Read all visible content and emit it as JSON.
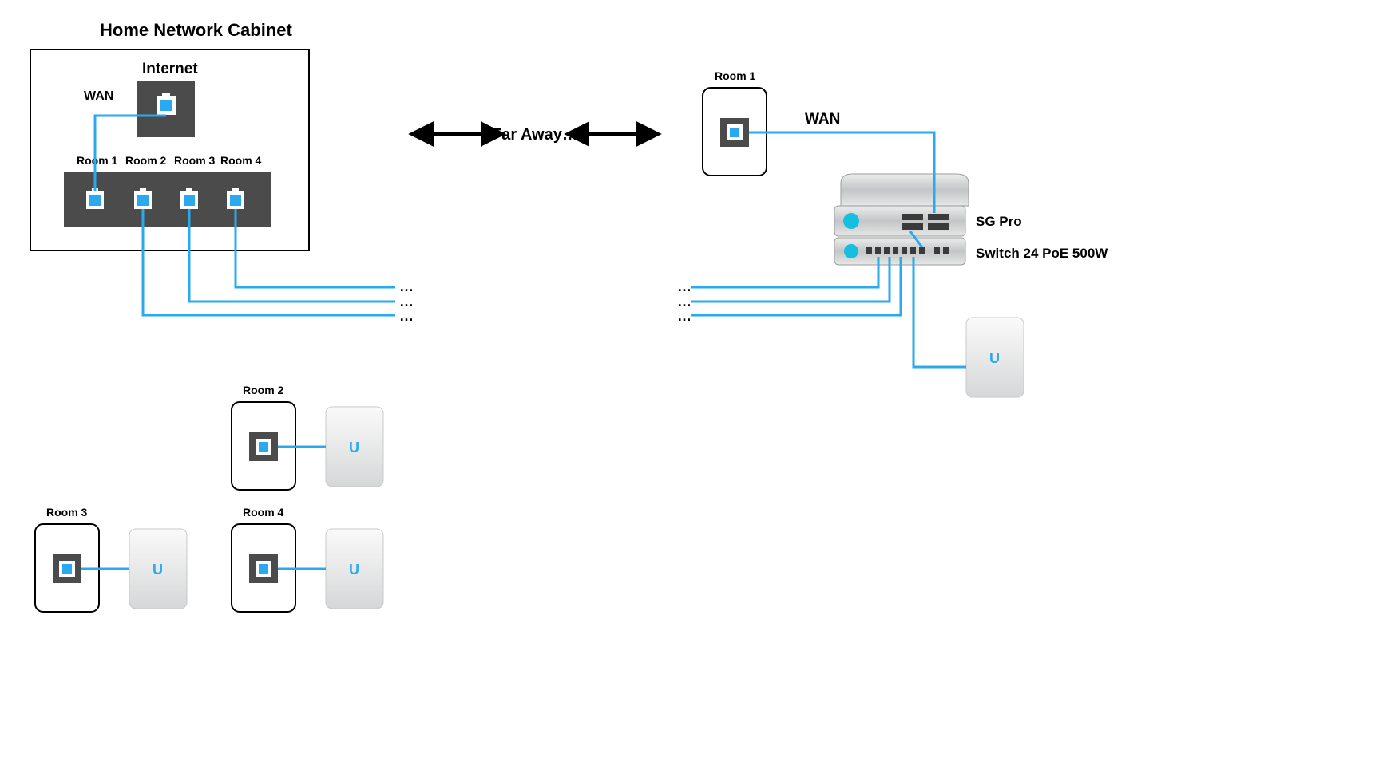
{
  "cabinet": {
    "title": "Home Network Cabinet",
    "internet": "Internet",
    "wan": "WAN",
    "rooms": [
      "Room 1",
      "Room 2",
      "Room 3",
      "Room 4"
    ]
  },
  "center": {
    "far_away": "Far Away…",
    "ell": "…"
  },
  "right": {
    "room1": "Room 1",
    "wan": "WAN",
    "sgpro": "SG Pro",
    "switch": "Switch 24 PoE 500W"
  },
  "bottom": {
    "room2": "Room 2",
    "room3": "Room 3",
    "room4": "Room 4"
  },
  "icon": {
    "u": "U"
  }
}
